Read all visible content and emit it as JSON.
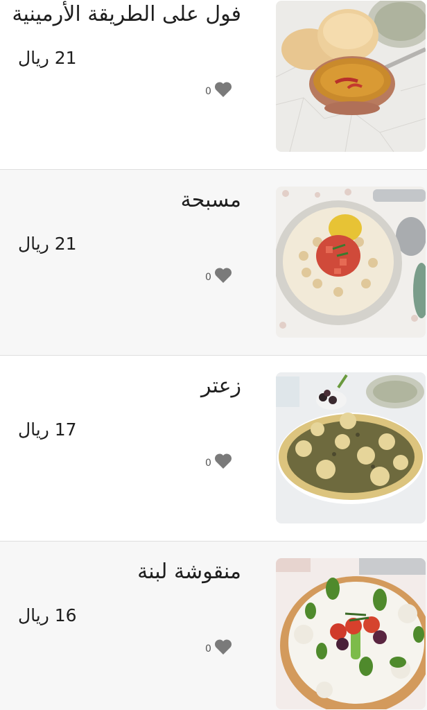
{
  "menu": {
    "items": [
      {
        "name": "فول على الطريقة الأرمينية",
        "price": "21 ريال",
        "likes": "0",
        "photo": "foul-armenian-dish"
      },
      {
        "name": "مسبحة",
        "price": "21 ريال",
        "likes": "0",
        "photo": "msabaha-dish"
      },
      {
        "name": "زعتر",
        "price": "17 ريال",
        "likes": "0",
        "photo": "zaatar-manakish"
      },
      {
        "name": "منقوشة لبنة",
        "price": "16 ريال",
        "likes": "0",
        "photo": "labneh-manakish"
      }
    ]
  },
  "colors": {
    "text": "#1e1e1e",
    "heart": "#7a7a7a",
    "alt_background": "#f7f7f7",
    "divider": "#dedede"
  }
}
